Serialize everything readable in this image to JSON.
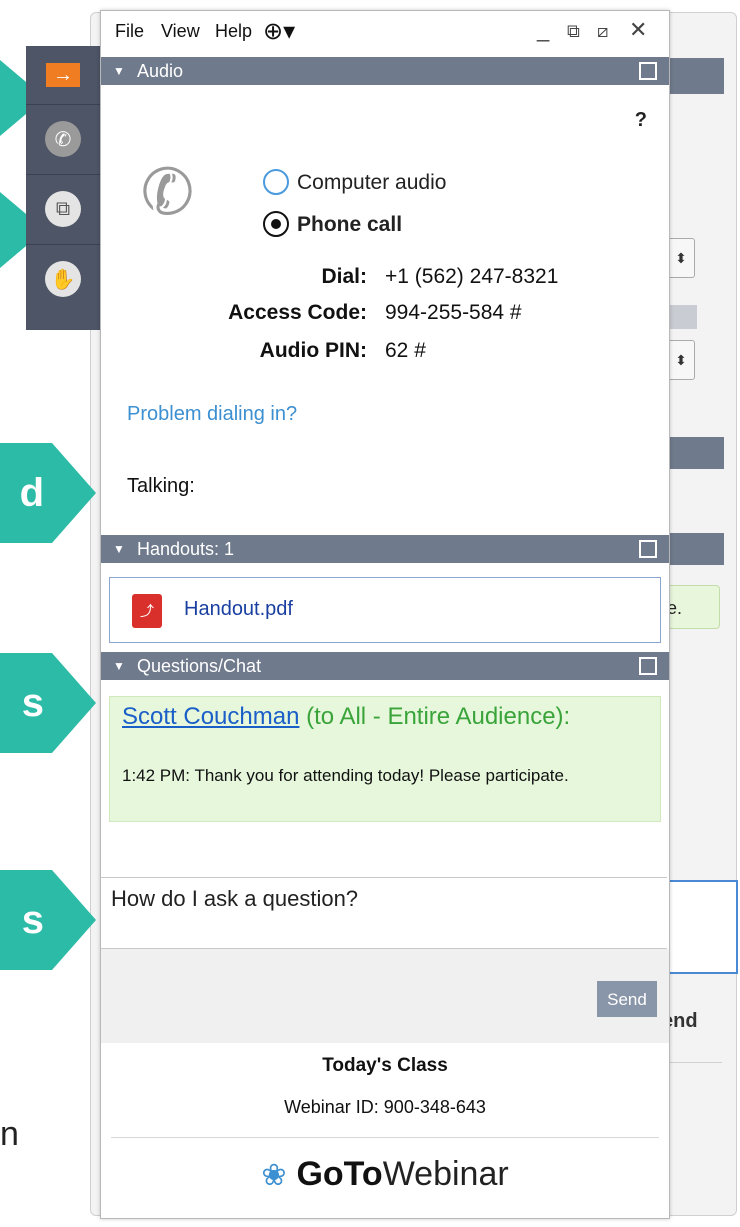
{
  "menu": {
    "file": "File",
    "view": "View",
    "help": "Help",
    "globe": "globe-icon"
  },
  "window_controls": {
    "minimize": "_",
    "restore": "⧉",
    "popout": "⧄",
    "close": "✕"
  },
  "audio": {
    "header": "Audio",
    "help": "?",
    "options": [
      {
        "label": "Computer audio",
        "selected": false
      },
      {
        "label": "Phone call",
        "selected": true
      }
    ],
    "dial_label": "Dial:",
    "dial_value": "+1 (562) 247-8321",
    "access_label": "Access Code:",
    "access_value": "994-255-584 #",
    "pin_label": "Audio PIN:",
    "pin_value": "62 #",
    "problem_link": "Problem dialing in?",
    "talking_label": "Talking:"
  },
  "handouts": {
    "header": "Handouts: 1",
    "file": "Handout.pdf"
  },
  "chat": {
    "header": "Questions/Chat",
    "sender": "Scott Couchman",
    "recipient": " (to All - Entire Audience):",
    "message": "1:42 PM: Thank you for attending today! Please participate.",
    "input_value": "How do I ask a question?",
    "send_label": "Send"
  },
  "footer": {
    "title": "Today's Class",
    "webinar_id": "Webinar ID: 900-348-643",
    "brand_bold": "GoTo",
    "brand_regular": "Webinar"
  },
  "callouts": {
    "c1": "d",
    "c2": "s",
    "c3": "s",
    "partial": "n"
  },
  "background": {
    "bubble_text": "e.",
    "send_text": "end"
  },
  "colors": {
    "section_header": "#6f7a8c",
    "callout": "#2cbba6",
    "toolbar": "#4d5566",
    "accent_orange": "#f07d21",
    "link": "#3c8fd0"
  }
}
